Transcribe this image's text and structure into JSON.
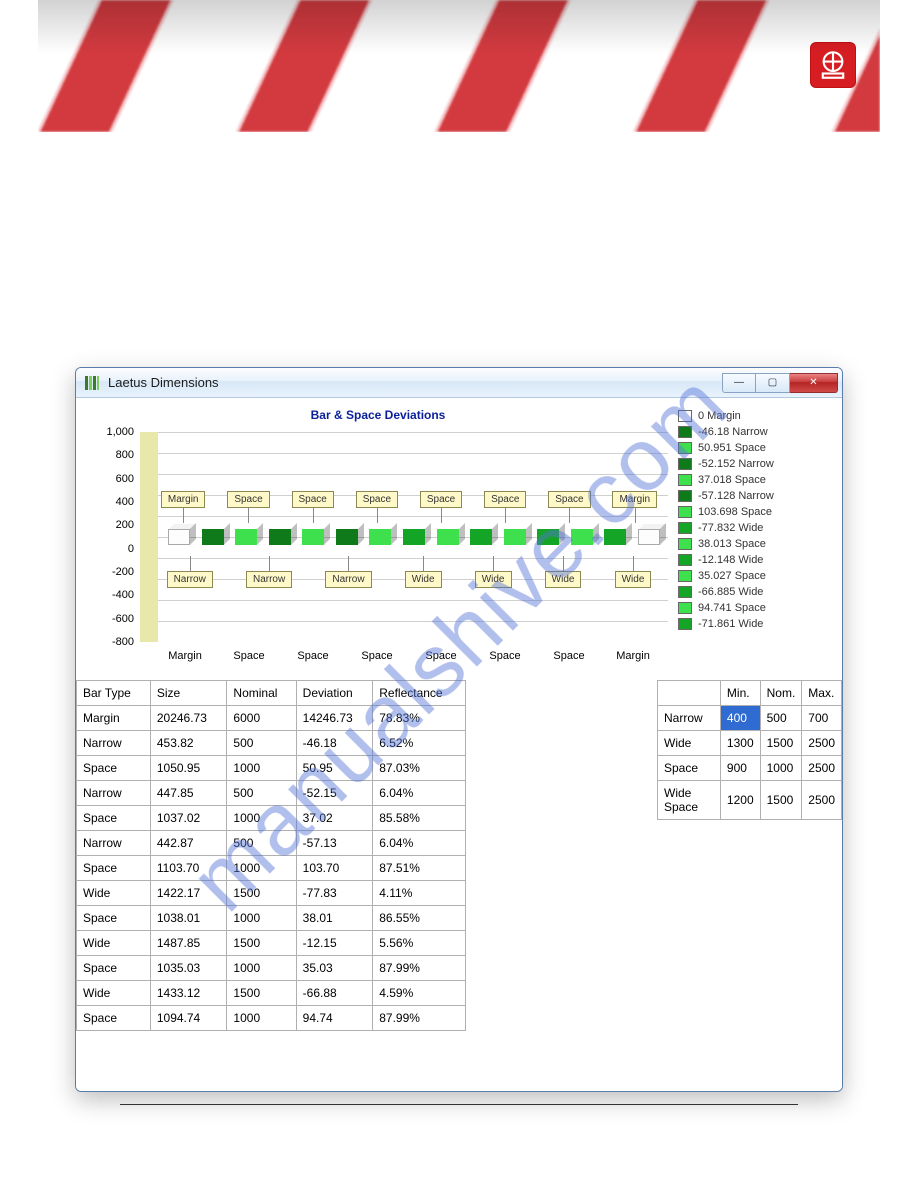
{
  "banner": {
    "logo_alt": "logo"
  },
  "watermark": "manualshive.com",
  "window": {
    "title": "Laetus Dimensions",
    "buttons": {
      "minimize": "—",
      "maximize": "▢",
      "close": "✕"
    }
  },
  "chart_data": {
    "type": "bar",
    "title": "Bar & Space Deviations",
    "ylim": [
      -800,
      1000
    ],
    "ytick": [
      "1,000",
      "800",
      "600",
      "400",
      "200",
      "0",
      "-200",
      "-400",
      "-600",
      "-800"
    ],
    "x_categories": [
      "Margin",
      "Space",
      "Space",
      "Space",
      "Space",
      "Space",
      "Space",
      "Margin"
    ],
    "callouts_top": [
      "Margin",
      "Space",
      "Space",
      "Space",
      "Space",
      "Space",
      "Space",
      "Margin"
    ],
    "callouts_bottom": [
      "Narrow",
      "Narrow",
      "Narrow",
      "Wide",
      "Wide",
      "Wide",
      "Wide"
    ],
    "legend": [
      {
        "swatch": "white",
        "label": "0 Margin"
      },
      {
        "swatch": "dg",
        "label": "-46.18 Narrow"
      },
      {
        "swatch": "lg",
        "label": "50.951 Space"
      },
      {
        "swatch": "dg",
        "label": "-52.152 Narrow"
      },
      {
        "swatch": "lg",
        "label": "37.018 Space"
      },
      {
        "swatch": "dg",
        "label": "-57.128 Narrow"
      },
      {
        "swatch": "lg",
        "label": "103.698 Space"
      },
      {
        "swatch": "mg",
        "label": "-77.832 Wide"
      },
      {
        "swatch": "lg",
        "label": "38.013 Space"
      },
      {
        "swatch": "mg",
        "label": "-12.148 Wide"
      },
      {
        "swatch": "lg",
        "label": "35.027 Space"
      },
      {
        "swatch": "mg",
        "label": "-66.885 Wide"
      },
      {
        "swatch": "lg",
        "label": "94.741 Space"
      },
      {
        "swatch": "mg",
        "label": "-71.861 Wide"
      }
    ],
    "bars": [
      {
        "c": "white"
      },
      {
        "c": "dg"
      },
      {
        "c": "lg"
      },
      {
        "c": "dg"
      },
      {
        "c": "lg"
      },
      {
        "c": "dg"
      },
      {
        "c": "lg"
      },
      {
        "c": "mg"
      },
      {
        "c": "lg"
      },
      {
        "c": "mg"
      },
      {
        "c": "lg"
      },
      {
        "c": "mg"
      },
      {
        "c": "lg"
      },
      {
        "c": "mg"
      },
      {
        "c": "white"
      }
    ]
  },
  "table_left": {
    "headers": [
      "Bar Type",
      "Size",
      "Nominal",
      "Deviation",
      "Reflectance"
    ],
    "rows": [
      [
        "Margin",
        "20246.73",
        "6000",
        "14246.73",
        "78.83%"
      ],
      [
        "Narrow",
        "453.82",
        "500",
        "-46.18",
        "6.52%"
      ],
      [
        "Space",
        "1050.95",
        "1000",
        "50.95",
        "87.03%"
      ],
      [
        "Narrow",
        "447.85",
        "500",
        "-52.15",
        "6.04%"
      ],
      [
        "Space",
        "1037.02",
        "1000",
        "37.02",
        "85.58%"
      ],
      [
        "Narrow",
        "442.87",
        "500",
        "-57.13",
        "6.04%"
      ],
      [
        "Space",
        "1103.70",
        "1000",
        "103.70",
        "87.51%"
      ],
      [
        "Wide",
        "1422.17",
        "1500",
        "-77.83",
        "4.11%"
      ],
      [
        "Space",
        "1038.01",
        "1000",
        "38.01",
        "86.55%"
      ],
      [
        "Wide",
        "1487.85",
        "1500",
        "-12.15",
        "5.56%"
      ],
      [
        "Space",
        "1035.03",
        "1000",
        "35.03",
        "87.99%"
      ],
      [
        "Wide",
        "1433.12",
        "1500",
        "-66.88",
        "4.59%"
      ],
      [
        "Space",
        "1094.74",
        "1000",
        "94.74",
        "87.99%"
      ]
    ]
  },
  "table_right": {
    "headers": [
      "",
      "Min.",
      "Nom.",
      "Max."
    ],
    "rows": [
      {
        "label": "Narrow",
        "min": "400",
        "nom": "500",
        "max": "700",
        "selected": true
      },
      {
        "label": "Wide",
        "min": "1300",
        "nom": "1500",
        "max": "2500"
      },
      {
        "label": "Space",
        "min": "900",
        "nom": "1000",
        "max": "2500"
      },
      {
        "label": "Wide Space",
        "min": "1200",
        "nom": "1500",
        "max": "2500"
      }
    ]
  }
}
